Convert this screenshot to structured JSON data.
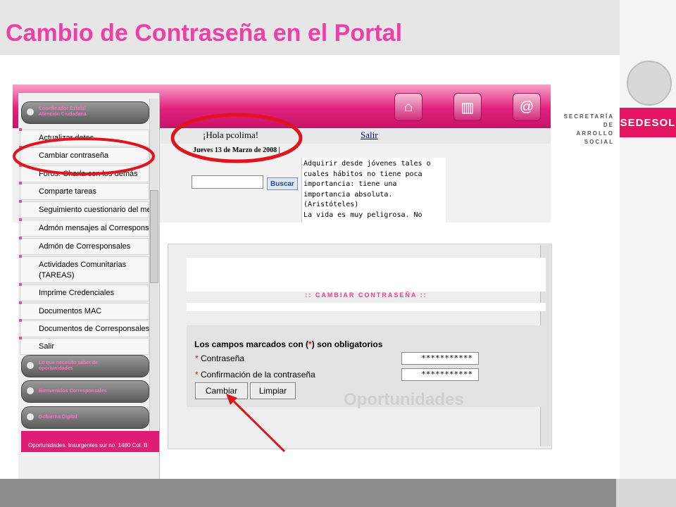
{
  "slide": {
    "title": "Cambio de Contraseña en el Portal",
    "secretaria_line1": "SECRETARÍA DE",
    "secretaria_line2": "ARROLLO SOCIAL",
    "badge": "SEDESOL"
  },
  "portal": {
    "greeting": "¡Hola pcolima!",
    "logout": "Salir",
    "date": "Jueves 13 de Marzo de 2008 |",
    "search_button": "Buscar",
    "quote": "Adquirir desde jóvenes tales o\ncuales hábitos no tiene poca\nimportancia: tiene una\nimportancia absoluta.\n(Aristóteles)\nLa vida es muy peligrosa. No",
    "header_icons": [
      "home-icon",
      "books-icon",
      "email-icon"
    ]
  },
  "menu": {
    "coordinator_line1": "Coordinador Estatal",
    "coordinator_line2": "Atención Ciudadana",
    "items": [
      "Actualizar datos",
      "Cambiar contraseña",
      "Foros: Charla con los demás",
      "Comparte tareas",
      "Seguimiento cuestionario del mes",
      "Admón mensajes al Corresponsal",
      "Admón de Corresponsales",
      "Actividades Comunitarias",
      "(TAREAS)",
      "Imprime Credenciales",
      "Documentos MAC",
      "Documentos de Corresponsales",
      "Salir"
    ],
    "pill_que_line1": "Lo que necesito saber  de",
    "pill_que_line2": "oportunidades",
    "pill_bienvenidos": "Bienvenidos  Corresponsales",
    "pill_gobierno": "Gobierno Digital",
    "address": "Oportunidades. Insurgentes sur no. 1480 Col. B"
  },
  "form": {
    "heading": ":: CAMBIAR CONTRASEÑA ::",
    "required_before": "Los campos marcados con (",
    "required_star": "*",
    "required_after": ") son obligatorios",
    "star": "*",
    "password_label": "Contraseña",
    "confirm_label": "Confirmación de la contraseña",
    "password_value": "***********",
    "confirm_value": "***********",
    "change_button": "Cambiar",
    "clear_button": "Limpiar",
    "watermark": "Oportunidades"
  },
  "colors": {
    "title": "#ec3fa8",
    "accent": "#e01d76",
    "annotation": "#e0141e"
  }
}
